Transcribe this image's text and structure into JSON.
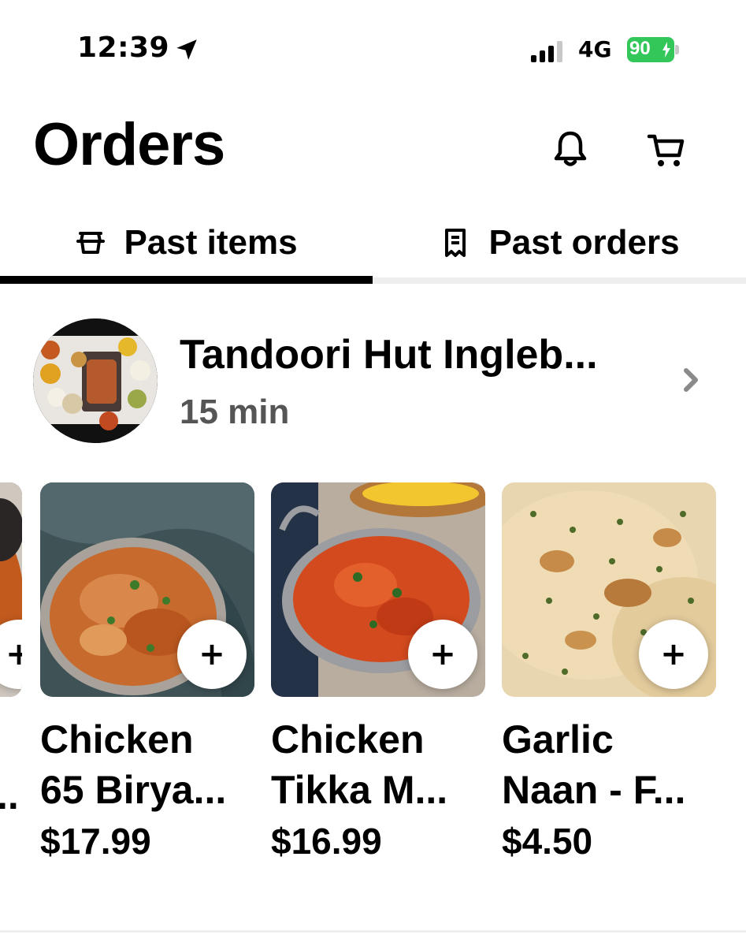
{
  "status_bar": {
    "time": "12:39",
    "network": "4G",
    "battery": "90",
    "icons": [
      "location-arrow-icon",
      "signal-icon",
      "battery-charging-icon"
    ]
  },
  "header": {
    "title": "Orders",
    "icons": [
      "bell-icon",
      "cart-icon"
    ]
  },
  "tabs": [
    {
      "label": "Past items",
      "icon": "basket-icon",
      "active": true
    },
    {
      "label": "Past orders",
      "icon": "receipt-icon",
      "active": false
    }
  ],
  "store": {
    "name": "Tandoori Hut Ingleb...",
    "eta": "15 min",
    "icon": "chevron-right-icon"
  },
  "items": [
    {
      "name_line1": "Chicken",
      "name_line2": "65 Birya...",
      "price": "$17.99",
      "add_label": "+"
    },
    {
      "name_line1": "Chicken",
      "name_line2": "Tikka M...",
      "price": "$16.99",
      "add_label": "+"
    },
    {
      "name_line1": "Garlic",
      "name_line2": "Naan - F...",
      "price": "$4.50",
      "add_label": "+"
    }
  ],
  "partial_item": {
    "name_fragment": ".."
  },
  "colors": {
    "accent": "#000000",
    "battery": "#33c659",
    "muted_text": "#555555"
  }
}
